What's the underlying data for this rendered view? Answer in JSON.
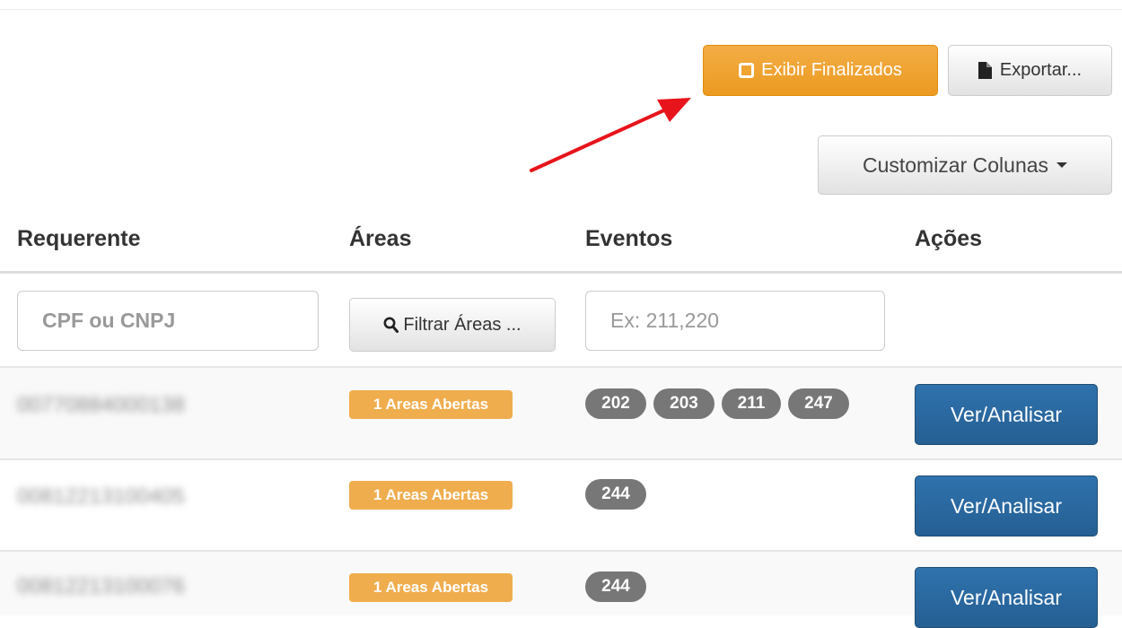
{
  "toolbar": {
    "show_finished_label": "Exibir Finalizados",
    "export_label": "Exportar...",
    "customize_columns_label": "Customizar Colunas"
  },
  "table": {
    "headers": {
      "requerente": "Requerente",
      "areas": "Áreas",
      "eventos": "Eventos",
      "acoes": "Ações"
    },
    "filters": {
      "cpf_placeholder": "CPF ou CNPJ",
      "areas_filter_label": "Filtrar Áreas ...",
      "eventos_placeholder": "Ex: 211,220"
    },
    "rows": [
      {
        "requerente": "00770884000138",
        "areas": "1 Areas Abertas",
        "eventos": [
          "202",
          "203",
          "211",
          "247"
        ],
        "action": "Ver/Analisar"
      },
      {
        "requerente": "00812213100405",
        "areas": "1 Areas Abertas",
        "eventos": [
          "244"
        ],
        "action": "Ver/Analisar"
      },
      {
        "requerente": "00812213100076",
        "areas": "1 Areas Abertas",
        "eventos": [
          "244"
        ],
        "action": "Ver/Analisar"
      }
    ]
  },
  "icons": {
    "toggle": "square-outline-icon",
    "export": "file-icon",
    "filter": "search-icon",
    "dropdown": "caret-down-icon"
  },
  "colors": {
    "warning": "#f0ad4e",
    "primary": "#286090",
    "badge": "#777777",
    "annotation_arrow": "#e8141b"
  }
}
